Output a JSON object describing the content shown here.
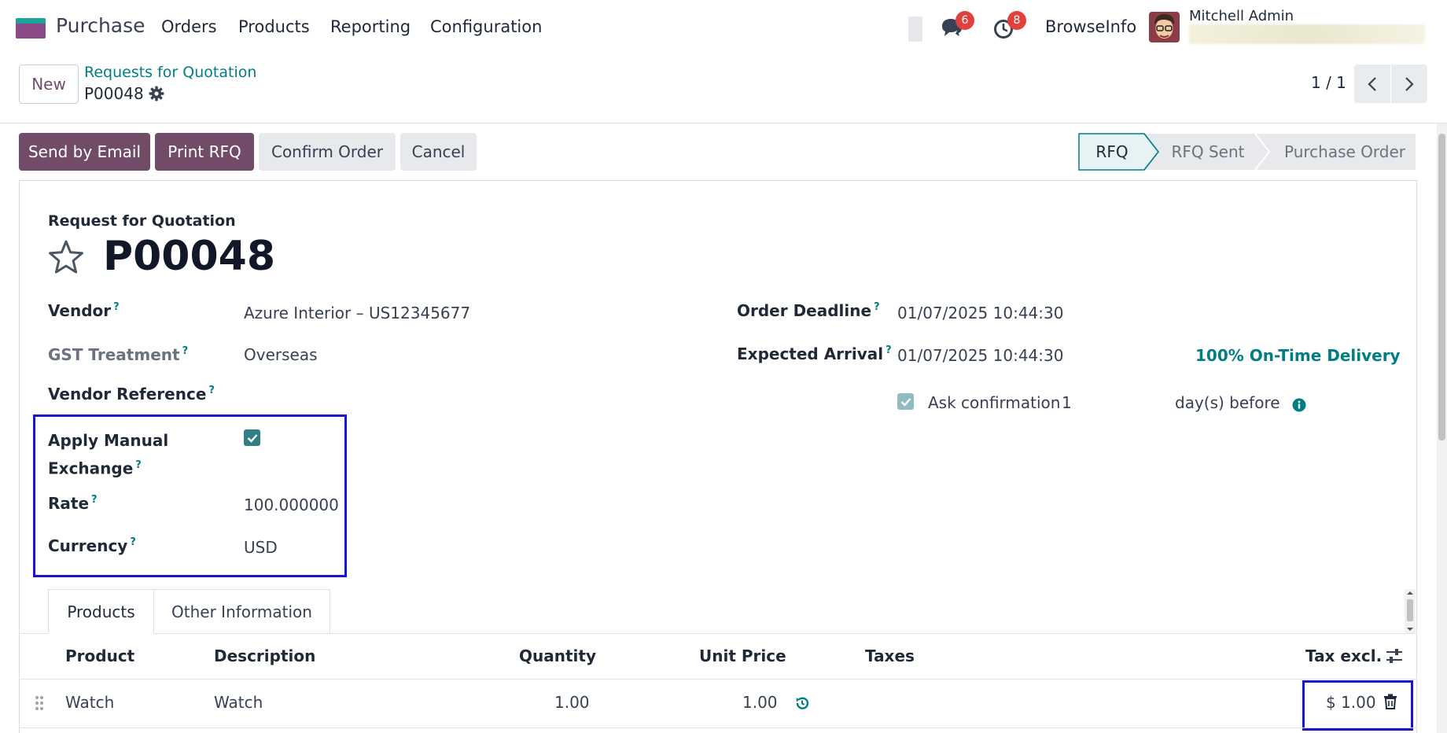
{
  "navbar": {
    "app_name": "Purchase",
    "menu": [
      "Orders",
      "Products",
      "Reporting",
      "Configuration"
    ],
    "chat_count": "6",
    "activity_count": "8",
    "company": "BrowseInfo",
    "user_name": "Mitchell Admin"
  },
  "control_panel": {
    "new_label": "New",
    "breadcrumb_parent": "Requests for Quotation",
    "breadcrumb_current": "P00048",
    "pager": "1 / 1"
  },
  "actions": {
    "send_email": "Send by Email",
    "print_rfq": "Print RFQ",
    "confirm_order": "Confirm Order",
    "cancel": "Cancel"
  },
  "status": {
    "steps": [
      "RFQ",
      "RFQ Sent",
      "Purchase Order"
    ],
    "active": "RFQ"
  },
  "form": {
    "subtitle": "Request for Quotation",
    "name": "P00048",
    "vendor_label": "Vendor",
    "vendor_value": "Azure Interior – US12345677",
    "gst_label": "GST Treatment",
    "gst_value": "Overseas",
    "vendor_ref_label": "Vendor Reference",
    "apply_manual_line1": "Apply Manual",
    "apply_manual_line2": "Exchange",
    "apply_manual_checked": true,
    "rate_label": "Rate",
    "rate_value": "100.000000",
    "currency_label": "Currency",
    "currency_value": "USD",
    "order_deadline_label": "Order Deadline",
    "order_deadline_value": "01/07/2025 10:44:30",
    "expected_arrival_label": "Expected Arrival",
    "expected_arrival_value": "01/07/2025 10:44:30",
    "on_time_delivery": "100% On-Time Delivery",
    "ask_confirmation_label": "Ask confirmation",
    "ask_confirmation_days": "1",
    "days_before": "day(s) before",
    "tooltip_mark": "?"
  },
  "tabs": [
    "Products",
    "Other Information"
  ],
  "table": {
    "columns": [
      "Product",
      "Description",
      "Quantity",
      "Unit Price",
      "Taxes",
      "Tax excl."
    ],
    "rows": [
      {
        "product": "Watch",
        "description": "Watch",
        "quantity": "1.00",
        "unit_price": "1.00",
        "taxes": "",
        "subtotal": "$ 1.00"
      }
    ]
  },
  "colors": {
    "primary": "#714b67",
    "link": "#017e84",
    "highlight": "#1515cf",
    "badge": "#e0413c"
  }
}
